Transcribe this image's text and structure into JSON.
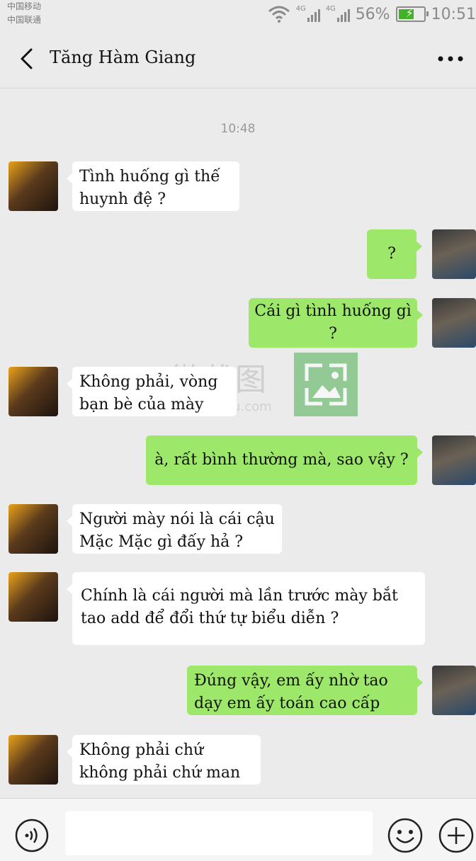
{
  "status_bar": {
    "carrier_1": "中国移动",
    "carrier_2": "中国联通",
    "network_1": "4G",
    "network_2": "4G",
    "battery": "56%",
    "time": "10:51",
    "wifi_icon": "wifi-icon",
    "battery_icon": "battery-charging-icon"
  },
  "header": {
    "title": "Tăng Hàm Giang",
    "back_icon": "chevron-left-icon",
    "more_icon": "more-dots-icon"
  },
  "chat": {
    "timestamp": "10:48",
    "messages": [
      {
        "side": "left",
        "text": "Tình huống gì thế huynh đệ ?"
      },
      {
        "side": "right",
        "text": "?"
      },
      {
        "side": "right",
        "text": "Cái gì tình huống gì ?"
      },
      {
        "side": "left",
        "text": "Không phải, vòng bạn bè của mày"
      },
      {
        "side": "right",
        "text": "à, rất bình thường mà, sao vậy ?"
      },
      {
        "side": "left",
        "text": "Người mày nói là cái cậu Mặc Mặc gì đấy hả ?"
      },
      {
        "side": "left",
        "text": "Chính là cái người mà lần trước mày bắt tao add để đổi thứ tự biểu diễn ?"
      },
      {
        "side": "right",
        "text": "Đúng vậy, em ấy nhờ tao dạy em ấy toán cao cấp"
      },
      {
        "side": "left",
        "text": "Không phải chứ không phải chứ man"
      }
    ]
  },
  "watermark": {
    "text": "微截图",
    "url": "etu.com"
  },
  "input_bar": {
    "voice_icon": "voice-icon",
    "emoji_icon": "emoji-icon",
    "plus_icon": "plus-icon",
    "text_value": ""
  },
  "colors": {
    "background": "#ebebeb",
    "sent_bubble": "#9de86a",
    "received_bubble": "#ffffff"
  }
}
